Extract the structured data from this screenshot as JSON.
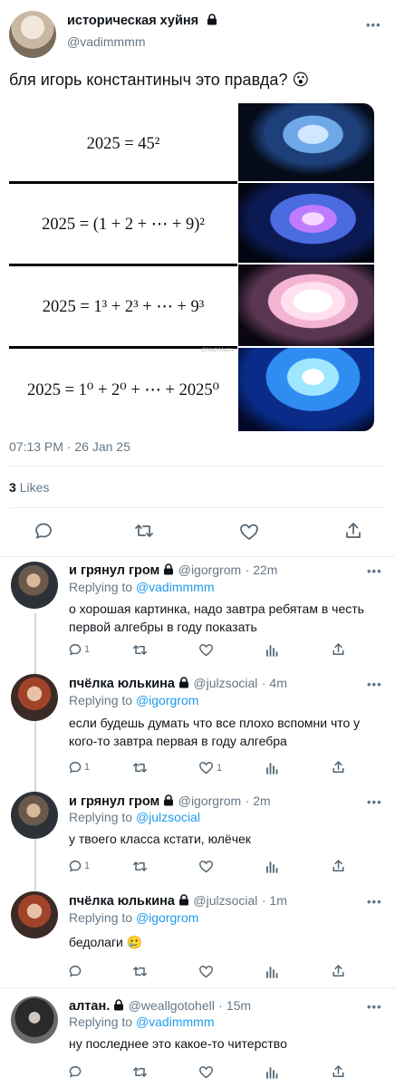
{
  "tweet": {
    "display_name": "историческая хуйня",
    "handle": "@vadimmmm",
    "text": "бля игорь константиныч это правда? 😮",
    "timestamp": "07:13 PM · 26 Jan 25",
    "likes_count": "3",
    "likes_label": "Likes",
    "more_label": "•••",
    "meme": {
      "rows": [
        {
          "formula": "2025 = 45²",
          "brain_level": 1
        },
        {
          "formula": "2025 = (1 + 2 + ⋯ + 9)²",
          "brain_level": 2
        },
        {
          "formula": "2025 = 1³ + 2³ + ⋯ + 9³",
          "brain_level": 3
        },
        {
          "formula": "2025 = 1⁰ + 2⁰ + ⋯ + 2025⁰",
          "brain_level": 4
        }
      ],
      "watermark": "@MathMatize"
    }
  },
  "replies": [
    {
      "name": "и грянул гром",
      "handle": "@igorgrom",
      "time": "· 22m",
      "replying_prefix": "Replying to",
      "replying_to": "@vadimmmm",
      "text": "о хорошая картинка, надо завтра ребятам в честь первой алгебры в году показать",
      "reply_count": "1",
      "like_count": "",
      "avatar_color": "#4a5560"
    },
    {
      "name": "пчёлка юлькина",
      "handle": "@julzsocial",
      "time": "· 4m",
      "replying_prefix": "Replying to",
      "replying_to": "@igorgrom",
      "text": "если будешь думать что все плохо вспомни что у кого-то завтра первая в году алгебра",
      "reply_count": "1",
      "like_count": "1",
      "avatar_color": "#8a4a2e"
    },
    {
      "name": "и грянул гром",
      "handle": "@igorgrom",
      "time": "· 2m",
      "replying_prefix": "Replying to",
      "replying_to": "@julzsocial",
      "text": "у твоего класса кстати, юлёчек",
      "reply_count": "1",
      "like_count": "",
      "avatar_color": "#4a5560"
    },
    {
      "name": "пчёлка юлькина",
      "handle": "@julzsocial",
      "time": "· 1m",
      "replying_prefix": "Replying to",
      "replying_to": "@igorgrom",
      "text": "бедолаги 🥲",
      "reply_count": "",
      "like_count": "",
      "avatar_color": "#8a4a2e"
    },
    {
      "name": "алтан.",
      "handle": "@weallgotohell",
      "time": "· 15m",
      "replying_prefix": "Replying to",
      "replying_to": "@vadimmmm",
      "text": "ну последнее это какое-то читерство",
      "reply_count": "",
      "like_count": "",
      "avatar_color": "#2a2a2a"
    }
  ],
  "colors": {
    "accent": "#1d9bf0",
    "secondary_text": "#657786",
    "divider": "#e6ecf0"
  },
  "icons": [
    "lock-icon",
    "reply-icon",
    "retweet-icon",
    "like-icon",
    "analytics-icon",
    "share-icon",
    "more-icon"
  ]
}
